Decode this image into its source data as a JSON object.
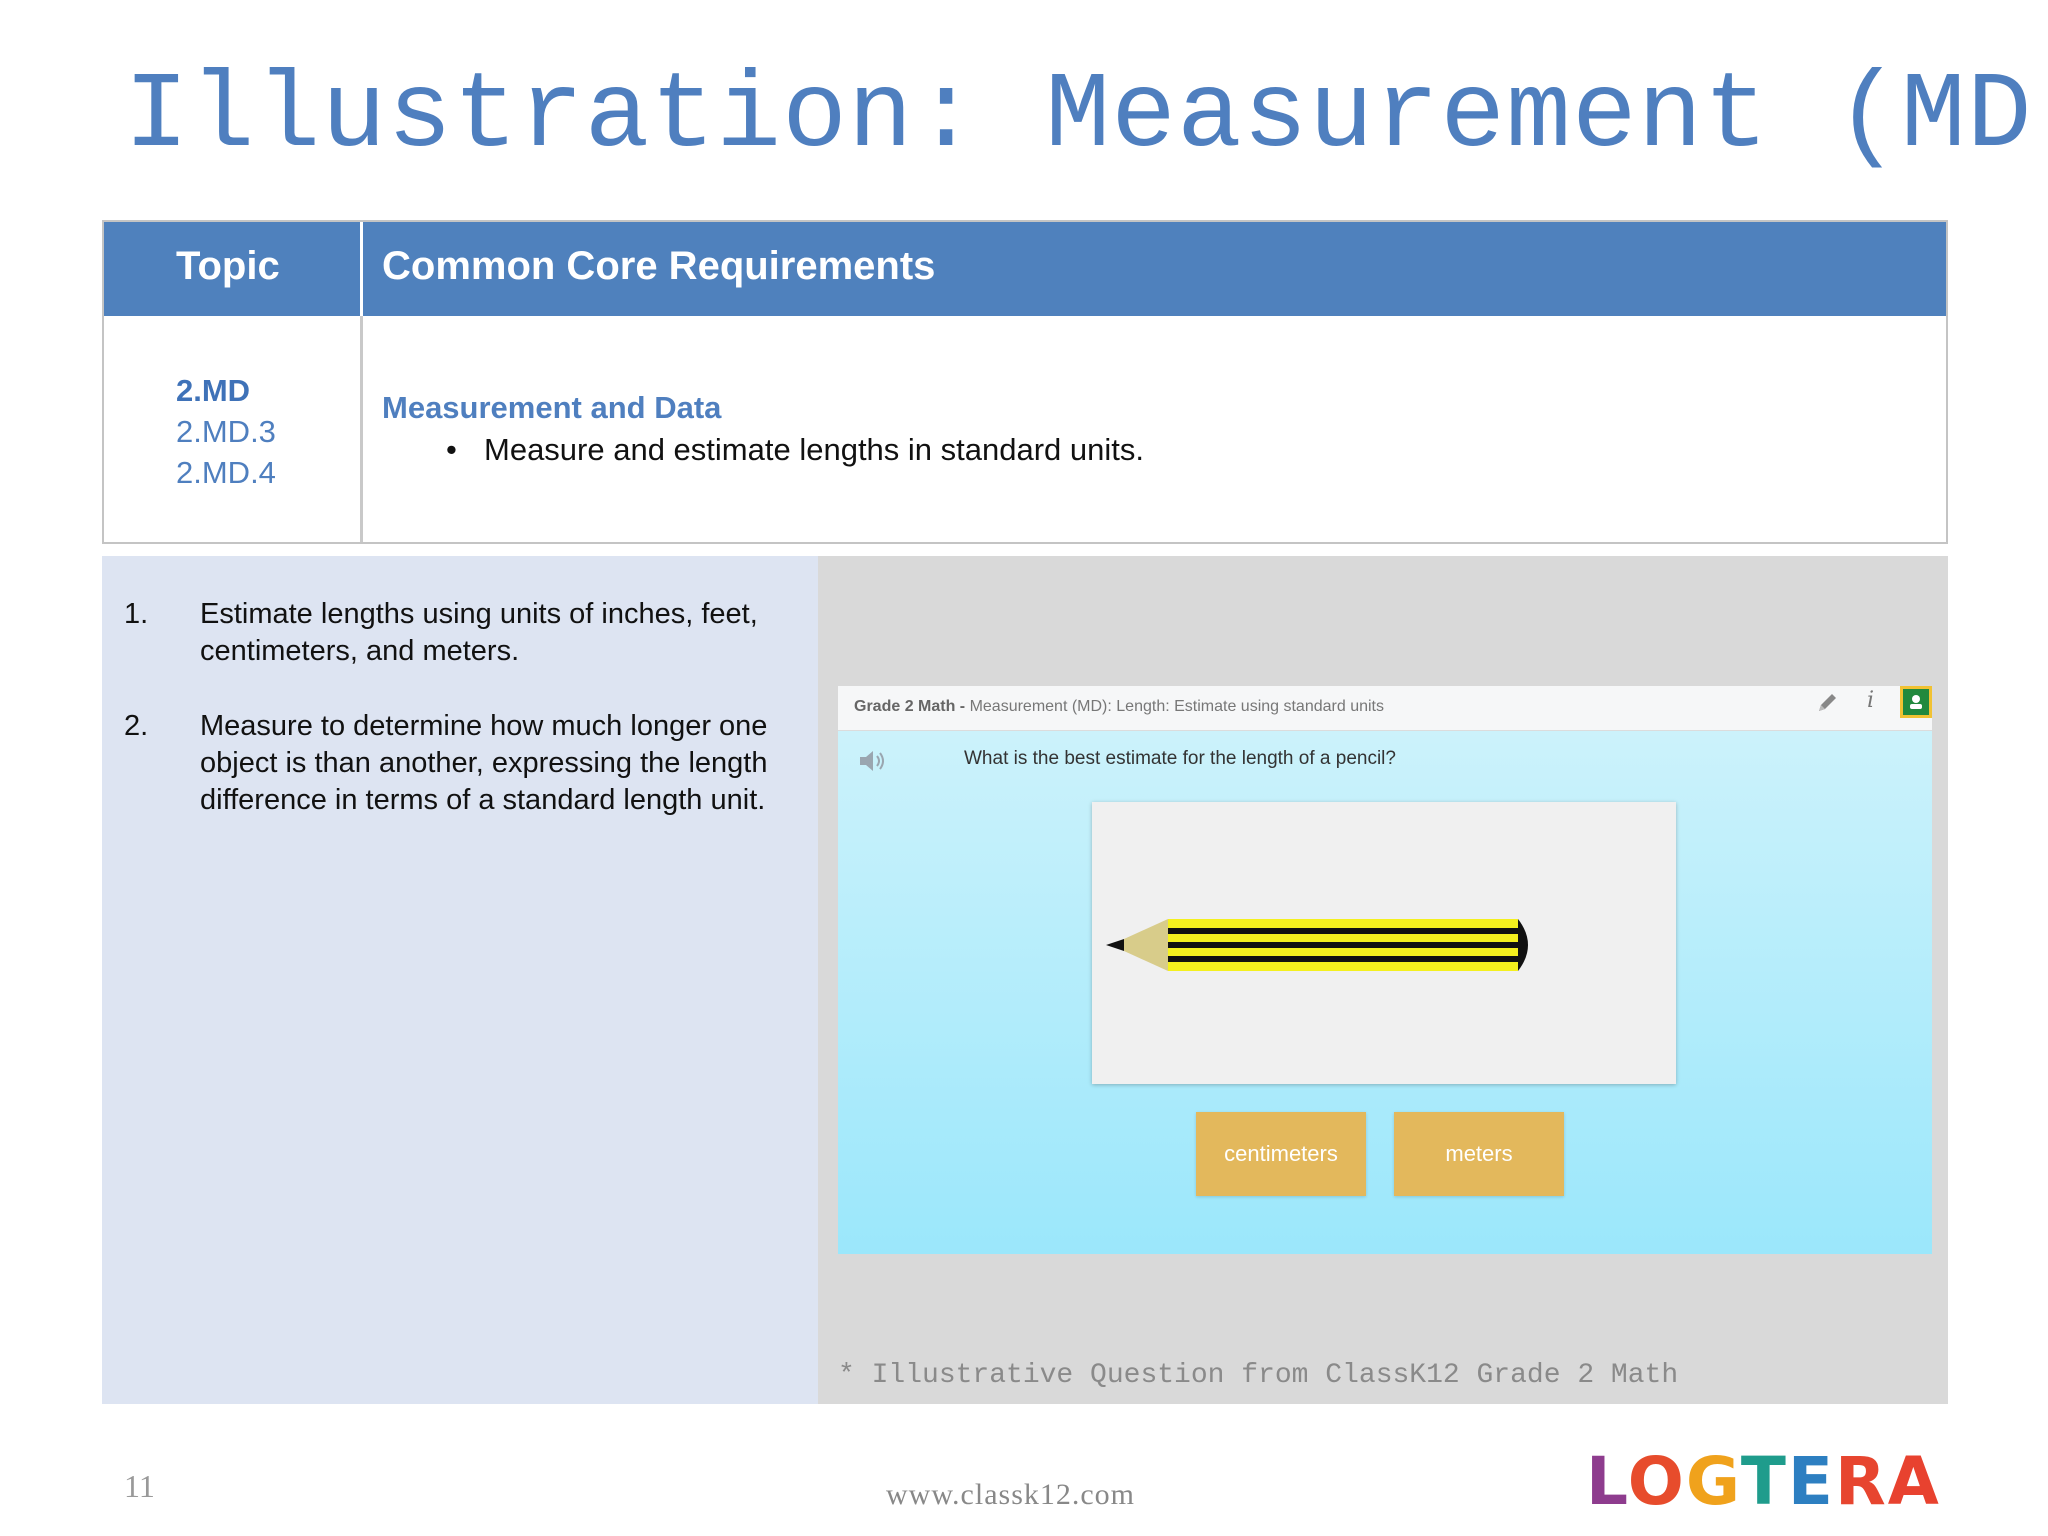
{
  "slide": {
    "title": "Illustration: Measurement (MD)",
    "page_number": "11",
    "footer_url": "www.classk12.com",
    "footnote": "* Illustrative Question from ClassK12 Grade 2 Math",
    "logo": {
      "letters": [
        "L",
        "O",
        "G",
        "T",
        "E",
        "R",
        "A"
      ],
      "colors": [
        "#8e3c8e",
        "#e74c2c",
        "#f0a21c",
        "#1f9c8c",
        "#2d7fc1",
        "#e7452f",
        "#e8422f"
      ]
    }
  },
  "standards_table": {
    "headers": {
      "topic": "Topic",
      "requirements": "Common Core Requirements"
    },
    "topic_main": "2.MD",
    "topic_codes": [
      "2.MD.3",
      "2.MD.4"
    ],
    "requirement_title": "Measurement and Data",
    "requirement_bullet": "Measure and estimate lengths in standard units."
  },
  "objectives": [
    {
      "num": "1.",
      "text": "Estimate lengths using units of inches, feet, centimeters, and meters."
    },
    {
      "num": "2.",
      "text": "Measure to determine how much longer one object is than another, expressing the length difference in terms of a standard length unit."
    }
  ],
  "quiz": {
    "breadcrumb_bold": "Grade 2 Math - ",
    "breadcrumb_rest": "Measurement (MD): Length: Estimate using standard units",
    "question": "What is the best estimate for the length of a pencil?",
    "answers": [
      "centimeters",
      "meters"
    ],
    "colors": {
      "answer_bg": "#e3b85c",
      "pencil_body": "#f4f01e"
    }
  },
  "colors": {
    "accent": "#4f81bd",
    "title": "#4f7fbf",
    "left_panel": "#dde4f2",
    "right_panel": "#d9d9d9"
  }
}
